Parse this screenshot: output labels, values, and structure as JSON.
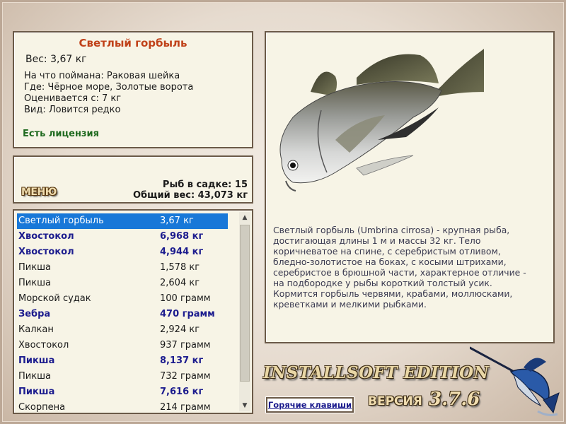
{
  "fish_info": {
    "title": "Светлый горбыль",
    "weight_line": "Вес: 3,67 кг",
    "rows": [
      "На что поймана: Раковая шейка",
      "Где: Чёрное море, Золотые ворота",
      "Оценивается с: 7 кг",
      "Вид: Ловится редко"
    ],
    "license": "Есть лицензия"
  },
  "menu": {
    "label": "МЕНЮ",
    "fish_count": "Рыб в садке: 15",
    "total_weight": "Общий вес: 43,073 кг"
  },
  "catch_list": [
    {
      "name": "Светлый горбыль",
      "weight": "3,67 кг",
      "bold": false,
      "selected": true
    },
    {
      "name": "Хвостокол",
      "weight": "6,968 кг",
      "bold": true,
      "selected": false
    },
    {
      "name": "Хвостокол",
      "weight": "4,944 кг",
      "bold": true,
      "selected": false
    },
    {
      "name": "Пикша",
      "weight": "1,578 кг",
      "bold": false,
      "selected": false
    },
    {
      "name": "Пикша",
      "weight": "2,604 кг",
      "bold": false,
      "selected": false
    },
    {
      "name": "Морской судак",
      "weight": "100 грамм",
      "bold": false,
      "selected": false
    },
    {
      "name": "Зебра",
      "weight": "470 грамм",
      "bold": true,
      "selected": false
    },
    {
      "name": "Калкан",
      "weight": "2,924 кг",
      "bold": false,
      "selected": false
    },
    {
      "name": "Хвостокол",
      "weight": "937 грамм",
      "bold": false,
      "selected": false
    },
    {
      "name": "Пикша",
      "weight": "8,137 кг",
      "bold": true,
      "selected": false
    },
    {
      "name": "Пикша",
      "weight": "732 грамм",
      "bold": false,
      "selected": false
    },
    {
      "name": "Пикша",
      "weight": "7,616 кг",
      "bold": true,
      "selected": false
    },
    {
      "name": "Скорпена",
      "weight": "214 грамм",
      "bold": false,
      "selected": false
    }
  ],
  "description": "Светлый горбыль (Umbrina cirrosa) - крупная рыба, достигающая длины 1 м и массы 32 кг. Тело коричневатое на спине, с серебристым отливом, бледно-золотистое на боках, с косыми штрихами, серебристое в брюшной части, характерное отличие - на подбородке у рыбы короткий толстый усик. Кормится горбыль червями, крабами, моллюсками, креветками и мелкими рыбками.",
  "brand": {
    "edition": "INSTALLSOFT EDITION",
    "version_label": "ВЕРСИЯ",
    "version": "3.7.6"
  },
  "hotkeys_label": "Горячие клавиши",
  "icons": {
    "fish": "fish-image-icon",
    "marlin": "marlin-logo-icon",
    "scroll_up": "scroll-up-arrow-icon",
    "scroll_down": "scroll-down-arrow-icon"
  },
  "colors": {
    "title": "#c0421a",
    "license": "#1f6a1f",
    "bold_row": "#1c1c8e",
    "selected_row": "#1878d8",
    "panel_bg": "#f7f4e6",
    "border": "#6b5a48"
  }
}
